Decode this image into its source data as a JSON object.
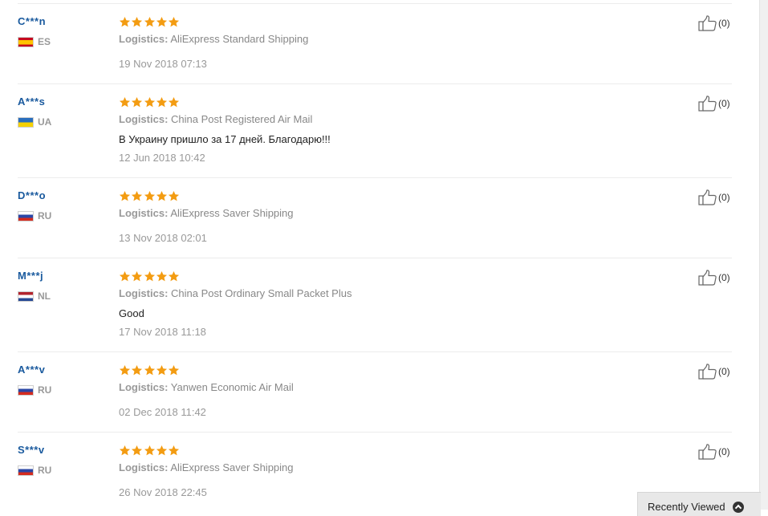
{
  "colors": {
    "username": "#1a5a9e",
    "star": "#f39c12",
    "muted": "#999999"
  },
  "logistics_label": "Logistics:",
  "reviews": [
    {
      "user": "C***n",
      "country": "ES",
      "rating": 5,
      "logistics": "AliExpress Standard Shipping",
      "text": "",
      "date": "19 Nov 2018 07:13",
      "helpful": "(0)"
    },
    {
      "user": "A***s",
      "country": "UA",
      "rating": 5,
      "logistics": "China Post Registered Air Mail",
      "text": "В Украину пришло за 17 дней. Благодарю!!!",
      "date": "12 Jun 2018 10:42",
      "helpful": "(0)"
    },
    {
      "user": "D***o",
      "country": "RU",
      "rating": 5,
      "logistics": "AliExpress Saver Shipping",
      "text": "",
      "date": "13 Nov 2018 02:01",
      "helpful": "(0)"
    },
    {
      "user": "M***j",
      "country": "NL",
      "rating": 5,
      "logistics": "China Post Ordinary Small Packet Plus",
      "text": "Good",
      "date": "17 Nov 2018 11:18",
      "helpful": "(0)"
    },
    {
      "user": "A***v",
      "country": "RU",
      "rating": 5,
      "logistics": "Yanwen Economic Air Mail",
      "text": "",
      "date": "02 Dec 2018 11:42",
      "helpful": "(0)"
    },
    {
      "user": "S***v",
      "country": "RU",
      "rating": 5,
      "logistics": "AliExpress Saver Shipping",
      "text": "",
      "date": "26 Nov 2018 22:45",
      "helpful": "(0)"
    }
  ],
  "recently_viewed": {
    "label": "Recently Viewed"
  }
}
